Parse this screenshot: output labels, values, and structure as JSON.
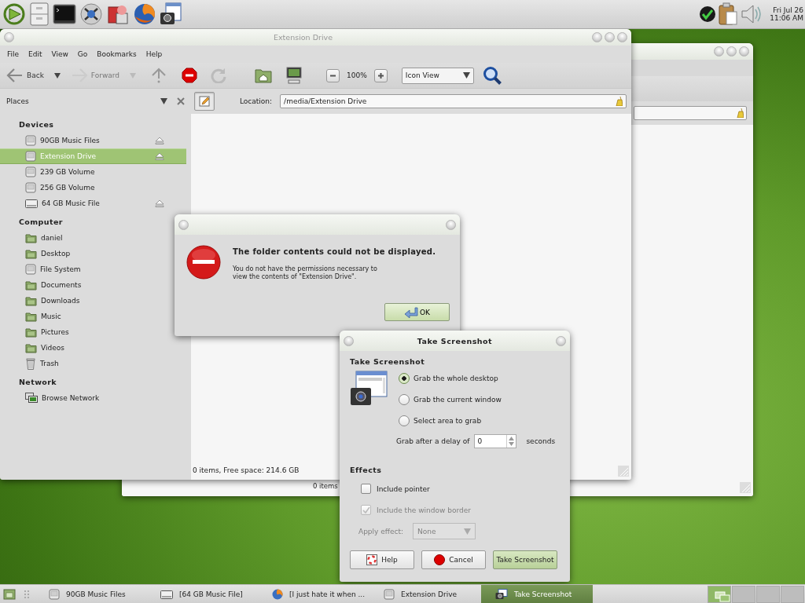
{
  "top_panel": {
    "clock": {
      "date": "Fri Jul 26",
      "time": "11:06 AM"
    }
  },
  "back_window": {
    "status": "0 items"
  },
  "file_window": {
    "title": "Extension Drive",
    "menu": [
      "File",
      "Edit",
      "View",
      "Go",
      "Bookmarks",
      "Help"
    ],
    "nav": [
      {
        "label": "Back",
        "disabled": false
      },
      {
        "label": "Forward",
        "disabled": true
      }
    ],
    "zoom": "100%",
    "view": "Icon View",
    "sidebar": {
      "title": "Places",
      "sections": [
        {
          "heading": "Devices",
          "items": [
            {
              "label": "90GB Music Files",
              "kind": "drive",
              "eject": true,
              "selected": false
            },
            {
              "label": "Extension Drive",
              "kind": "drive",
              "eject": true,
              "selected": true
            },
            {
              "label": "239 GB Volume",
              "kind": "drive",
              "eject": false,
              "selected": false
            },
            {
              "label": "256 GB Volume",
              "kind": "drive",
              "eject": false,
              "selected": false
            },
            {
              "label": "64 GB Music File",
              "kind": "removable",
              "eject": true,
              "selected": false
            }
          ]
        },
        {
          "heading": "Computer",
          "items": [
            {
              "label": "daniel",
              "kind": "folder",
              "eject": false,
              "selected": false
            },
            {
              "label": "Desktop",
              "kind": "folder",
              "eject": false,
              "selected": false
            },
            {
              "label": "File System",
              "kind": "drive",
              "eject": false,
              "selected": false
            },
            {
              "label": "Documents",
              "kind": "folder",
              "eject": false,
              "selected": false
            },
            {
              "label": "Downloads",
              "kind": "folder",
              "eject": false,
              "selected": false
            },
            {
              "label": "Music",
              "kind": "folder",
              "eject": false,
              "selected": false
            },
            {
              "label": "Pictures",
              "kind": "folder",
              "eject": false,
              "selected": false
            },
            {
              "label": "Videos",
              "kind": "folder",
              "eject": false,
              "selected": false
            },
            {
              "label": "Trash",
              "kind": "trash",
              "eject": false,
              "selected": false
            }
          ]
        },
        {
          "heading": "Network",
          "items": [
            {
              "label": "Browse Network",
              "kind": "network",
              "eject": false,
              "selected": false
            }
          ]
        }
      ]
    },
    "location": {
      "label": "Location:",
      "value": "/media/Extension Drive"
    },
    "status": "0 items, Free space: 214.6 GB"
  },
  "error_dialog": {
    "heading": "The folder contents could not be displayed.",
    "message": "You do not have the permissions necessary to\nview the contents of \"Extension Drive\".",
    "button": "OK"
  },
  "screenshot_dialog": {
    "title": "Take Screenshot",
    "section": "Take Screenshot",
    "options": [
      {
        "label": "Grab the whole desktop",
        "selected": true
      },
      {
        "label": "Grab the current window",
        "selected": false
      },
      {
        "label": "Select area to grab",
        "selected": false
      }
    ],
    "delay": {
      "label": "Grab after a delay of",
      "value": "0",
      "unit": "seconds"
    },
    "effects": {
      "heading": "Effects",
      "checks": [
        {
          "label": "Include pointer",
          "checked": false,
          "disabled": false
        },
        {
          "label": "Include the window border",
          "checked": true,
          "disabled": true
        }
      ],
      "apply": {
        "label": "Apply effect:",
        "value": "None",
        "disabled": true
      }
    },
    "buttons": [
      {
        "label": "Help",
        "kind": "help"
      },
      {
        "label": "Cancel",
        "kind": "cancel"
      },
      {
        "label": "Take Screenshot",
        "kind": "default"
      }
    ]
  },
  "taskbar": {
    "tasks": [
      {
        "label": "90GB Music Files",
        "kind": "drive",
        "selected": false
      },
      {
        "label": "[64 GB Music File]",
        "kind": "removable",
        "selected": false
      },
      {
        "label": "[I just hate it when ...",
        "kind": "browser",
        "selected": false
      },
      {
        "label": "Extension Drive",
        "kind": "drive",
        "selected": false
      },
      {
        "label": "Take Screenshot",
        "kind": "screenshot",
        "selected": true
      }
    ],
    "workspaces": [
      {
        "selected": true
      },
      {
        "selected": false
      },
      {
        "selected": false
      },
      {
        "selected": false
      }
    ]
  }
}
